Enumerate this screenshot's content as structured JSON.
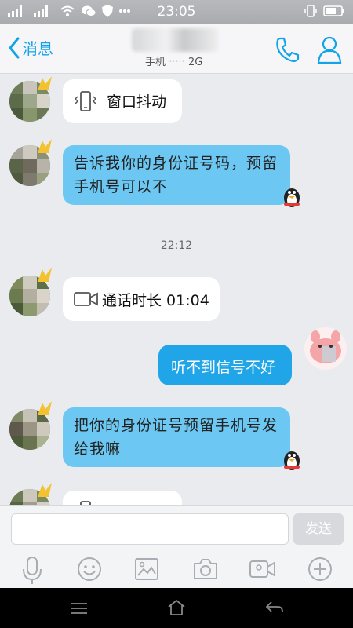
{
  "status_bar": {
    "time": "23:05"
  },
  "header": {
    "back_label": "消息",
    "subtitle_network": "2G",
    "subtitle_prefix": "手机"
  },
  "messages": {
    "shake": {
      "text": "窗口抖动"
    },
    "id_request": {
      "line1": "告诉我你的身份证号码，预留",
      "line2": "手机号可以不"
    },
    "timestamp": "22:12",
    "call": {
      "text": "通话时长 01:04"
    },
    "outgoing": {
      "text": "听不到信号不好"
    },
    "id_request_2": {
      "line1": "把你的身份证号预留手机号发",
      "line2": "给我嘛"
    }
  },
  "input": {
    "placeholder": "",
    "send_label": "发送"
  },
  "icons": {
    "status": [
      "signal-icon",
      "signal-icon",
      "wifi-icon",
      "wechat-icon",
      "shield-icon",
      "more-icon",
      "vibrate-icon",
      "battery-icon"
    ],
    "toolbar": [
      "microphone-icon",
      "emoji-icon",
      "image-icon",
      "camera-icon",
      "video-call-icon",
      "plus-icon"
    ],
    "nav": [
      "menu-icon",
      "home-icon",
      "back-icon"
    ]
  },
  "colors": {
    "accent": "#12a3e8",
    "incoming_bubble": "#6cc8f2",
    "outgoing_bubble": "#20a6e8"
  }
}
